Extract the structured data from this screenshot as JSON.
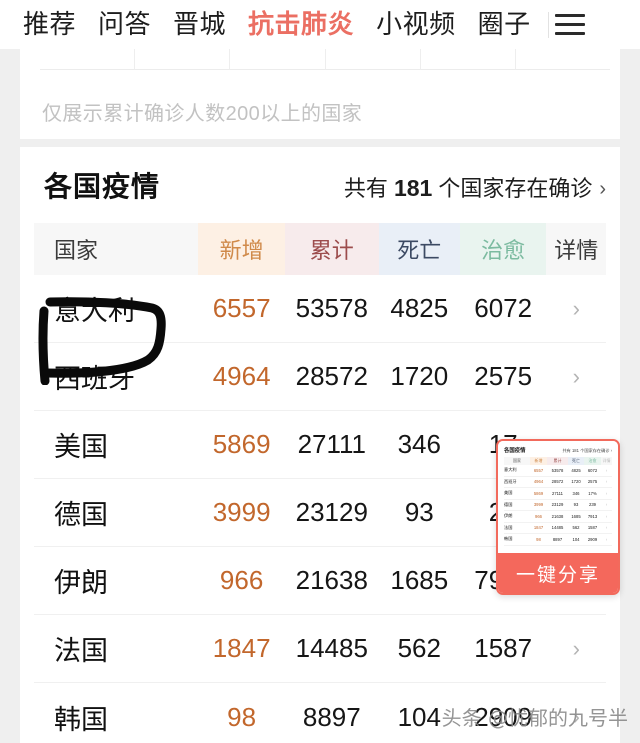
{
  "nav": {
    "items": [
      {
        "label": "推荐",
        "active": false
      },
      {
        "label": "问答",
        "active": false
      },
      {
        "label": "晋城",
        "active": false
      },
      {
        "label": "抗击肺炎",
        "active": true
      },
      {
        "label": "小视频",
        "active": false
      },
      {
        "label": "圈子",
        "active": false
      }
    ],
    "menu_icon": "hamburger-menu-icon",
    "active_color": "#eb6f63"
  },
  "note": {
    "text": "仅展示累计确诊人数200以上的国家"
  },
  "section": {
    "title": "各国疫情",
    "summary_prefix": "共有",
    "summary_count": "181",
    "summary_suffix": "个国家存在确诊",
    "chevron": "›"
  },
  "table": {
    "headers": [
      {
        "label": "国家",
        "bg": "#f7f7f7",
        "color": "#3b3b3b"
      },
      {
        "label": "新增",
        "bg": "#fdf0e4",
        "color": "#d08a4a"
      },
      {
        "label": "累计",
        "bg": "#f7ebec",
        "color": "#9c4c4c"
      },
      {
        "label": "死亡",
        "bg": "#e9eff7",
        "color": "#3c4a63"
      },
      {
        "label": "治愈",
        "bg": "#e9f4ef",
        "color": "#7cbba0"
      },
      {
        "label": "详情",
        "bg": "#f7f7f7",
        "color": "#3b3b3b"
      }
    ],
    "rows": [
      {
        "country": "意大利",
        "new": "6557",
        "total": "53578",
        "death": "4825",
        "cure": "6072",
        "detail": "›"
      },
      {
        "country": "西班牙",
        "new": "4964",
        "total": "28572",
        "death": "1720",
        "cure": "2575",
        "detail": "›"
      },
      {
        "country": "美国",
        "new": "5869",
        "total": "27111",
        "death": "346",
        "cure": "17",
        "detail": "›"
      },
      {
        "country": "德国",
        "new": "3999",
        "total": "23129",
        "death": "93",
        "cure": "23",
        "detail": "›"
      },
      {
        "country": "伊朗",
        "new": "966",
        "total": "21638",
        "death": "1685",
        "cure": "7913",
        "detail": "›"
      },
      {
        "country": "法国",
        "new": "1847",
        "total": "14485",
        "death": "562",
        "cure": "1587",
        "detail": "›"
      },
      {
        "country": "韩国",
        "new": "98",
        "total": "8897",
        "death": "104",
        "cure": "2909",
        "detail": "›"
      }
    ]
  },
  "share_popup": {
    "button_label": "一键分享",
    "button_color": "#f4685c",
    "border_color": "#f26a5c",
    "mini": {
      "title": "各国疫情",
      "summary": "共有 181 个国家存在确诊 ›",
      "headers": [
        "国家",
        "新增",
        "累计",
        "死亡",
        "治愈",
        "详情"
      ],
      "rows": [
        {
          "country": "意大利",
          "new": "6557",
          "total": "53578",
          "death": "4825",
          "cure": "6072",
          "detail": "›"
        },
        {
          "country": "西班牙",
          "new": "4964",
          "total": "28572",
          "death": "1720",
          "cure": "2575",
          "detail": "›"
        },
        {
          "country": "美国",
          "new": "5869",
          "total": "27111",
          "death": "346",
          "cure": "17%",
          "detail": "›"
        },
        {
          "country": "德国",
          "new": "3999",
          "total": "23129",
          "death": "93",
          "cure": "239",
          "detail": "›"
        },
        {
          "country": "伊朗",
          "new": "966",
          "total": "21638",
          "death": "1685",
          "cure": "7913",
          "detail": "›"
        },
        {
          "country": "法国",
          "new": "1847",
          "total": "14485",
          "death": "562",
          "cure": "1587",
          "detail": "›"
        },
        {
          "country": "韩国",
          "new": "98",
          "total": "8897",
          "death": "104",
          "cure": "2909",
          "detail": "›"
        }
      ]
    }
  },
  "watermark": {
    "text": "头条 @忧郁的九号半"
  },
  "annotation": {
    "shape": "hand-drawn-bracket",
    "color": "#000000",
    "target": "意大利"
  }
}
